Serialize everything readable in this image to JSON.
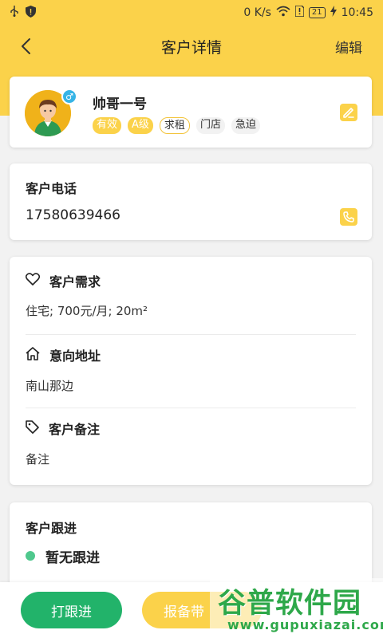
{
  "statusbar": {
    "speed": "0 K/s",
    "battery": "21",
    "time": "10:45"
  },
  "nav": {
    "title": "客户详情",
    "edit_label": "编辑"
  },
  "customer": {
    "name": "帅哥一号",
    "gender_symbol": "♂",
    "tags": [
      "有效",
      "A级",
      "求租",
      "门店",
      "急迫"
    ]
  },
  "phone": {
    "label": "客户电话",
    "number": "17580639466"
  },
  "details": {
    "demand": {
      "label": "客户需求",
      "value": "住宅; 700元/月; 20m²"
    },
    "address": {
      "label": "意向地址",
      "value": "南山那边"
    },
    "note": {
      "label": "客户备注",
      "value": "备注"
    }
  },
  "follow": {
    "title": "客户跟进",
    "empty_text": "暂无跟进"
  },
  "bottom": {
    "follow_button": "打跟进",
    "report_button": "报备带"
  },
  "watermark": {
    "name": "谷普软件园",
    "url": "www.gupuxiazai.com"
  },
  "colors": {
    "accent": "#fbd24a",
    "green": "#22b36a",
    "gender": "#36b4e6"
  }
}
